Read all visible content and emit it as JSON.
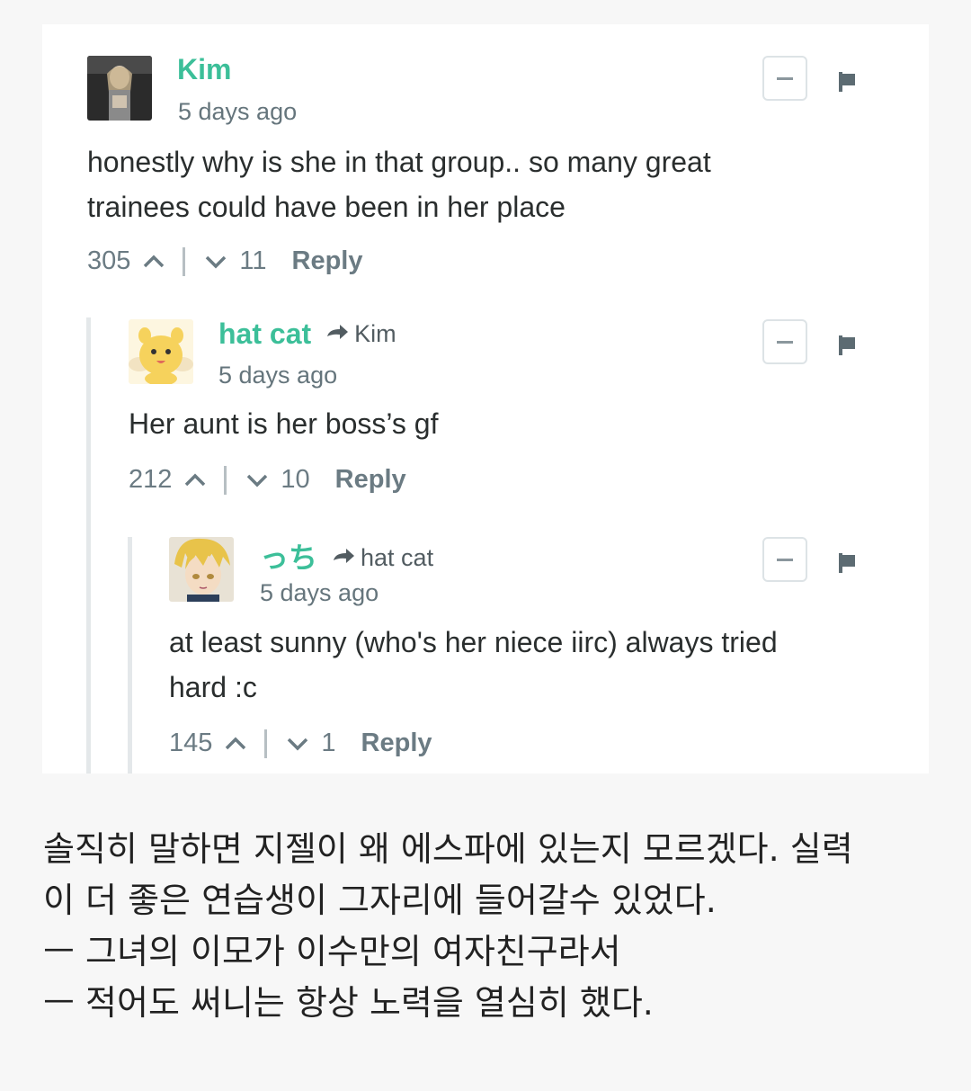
{
  "comments": [
    {
      "author": "Kim",
      "time": "5 days ago",
      "lines": [
        "honestly why is she in that group.. so many great",
        "trainees could have been in her place"
      ],
      "upvotes": "305",
      "downvotes": "11",
      "reply_label": "Reply",
      "avatar": "dark-photo-avatar"
    },
    {
      "author": "hat cat",
      "reply_to": "Kim",
      "time": "5 days ago",
      "lines": [
        "Her aunt is her boss’s gf"
      ],
      "upvotes": "212",
      "downvotes": "10",
      "reply_label": "Reply",
      "avatar": "yellow-cartoon-avatar"
    },
    {
      "author": "っち",
      "reply_to": "hat cat",
      "time": "5 days ago",
      "lines": [
        "at least sunny (who's her niece iirc) always tried",
        "hard :c"
      ],
      "upvotes": "145",
      "downvotes": "1",
      "reply_label": "Reply",
      "avatar": "anime-boy-avatar"
    }
  ],
  "translation": [
    "솔직히 말하면 지젤이 왜 에스파에 있는지 모르겠다. 실력",
    "이 더 좋은 연습생이 그자리에 들어갈수 있었다.",
    "ㅡ 그녀의 이모가 이수만의 여자친구라서",
    "ㅡ 적어도 써니는 항상 노력을 열심히 했다."
  ],
  "colors": {
    "author": "#3cbf99",
    "meta": "#65757c",
    "text": "#2a2e2e"
  }
}
